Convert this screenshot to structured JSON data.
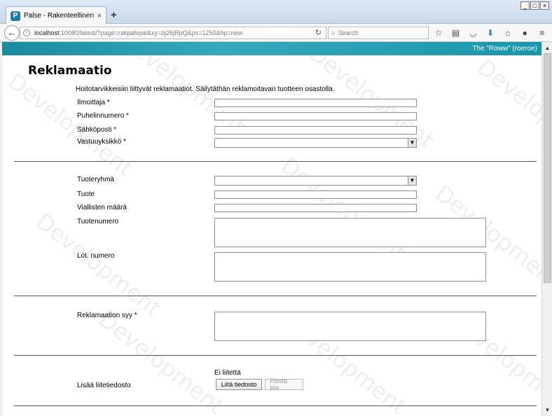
{
  "browser": {
    "tab_title": "Palse - Rakenteellinen palvelu...",
    "url_host": "localhost",
    "url_rest": ":10080/latest/?page=rakpalvpal&xy=bj26jRpQ&ps=1250&hp=new",
    "search_placeholder": "Search",
    "new_tab": "+",
    "close_tab": "×",
    "window_buttons": [
      "_",
      "□",
      "×"
    ],
    "icons": [
      "star-icon",
      "clipboard-icon",
      "pocket-icon",
      "download-icon",
      "home-icon",
      "chat-icon",
      "menu-icon"
    ]
  },
  "header": {
    "user": "The \"Roww\" (roeroe)",
    "accent": "#1a8aa0"
  },
  "watermark": "Development",
  "form": {
    "title": "Reklamaatio",
    "intro": "Hoitotarvikkeisiin liittyvät reklamaatiot. Säilytäthän reklamoitavan tuotteen osastolla.",
    "section1": {
      "reporter": "Ilmoittaja *",
      "phone": "Puhelinnumero *",
      "email": "Sähköposti *",
      "unit": "Vastuuyksikkö *"
    },
    "section2": {
      "product_group": "Tuoteryhmä",
      "product": "Tuote",
      "defect_count": "Viallisten määrä",
      "product_number": "Tuotenumero",
      "lot_number": "Lot. numero"
    },
    "section3": {
      "reason": "Reklamaation syy *"
    },
    "section4": {
      "attachment_label": "Lisää liitetiedosto",
      "attachment_status": "Ei liitettä",
      "upload_button": "Liitä tiedosto",
      "remove_button": "Poista liite"
    }
  }
}
